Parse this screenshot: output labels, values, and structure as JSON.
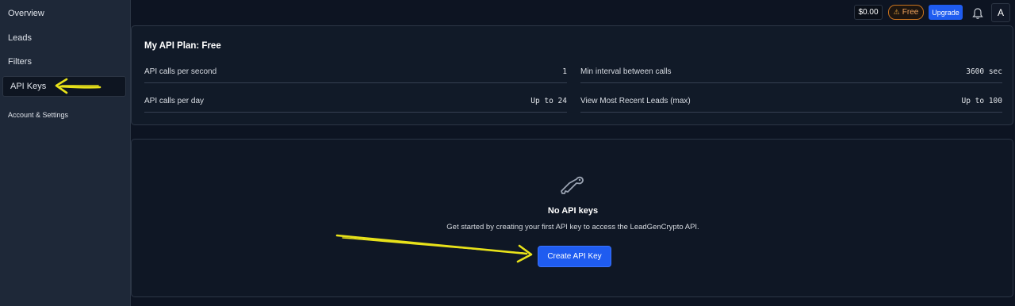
{
  "sidebar": {
    "items": [
      {
        "label": "Overview"
      },
      {
        "label": "Leads"
      },
      {
        "label": "Filters"
      },
      {
        "label": "API Keys",
        "active": true
      },
      {
        "label": "Account & Settings"
      }
    ]
  },
  "topbar": {
    "balance": "$0.00",
    "plan_badge": "Free",
    "upgrade_label": "Upgrade",
    "avatar_initial": "A"
  },
  "plan": {
    "title": "My API Plan: Free",
    "rows": [
      {
        "label": "API calls per second",
        "value": "1"
      },
      {
        "label": "Min interval between calls",
        "value": "3600 sec"
      },
      {
        "label": "API calls per day",
        "value": "Up to 24"
      },
      {
        "label": "View Most Recent Leads (max)",
        "value": "Up to 100"
      }
    ]
  },
  "empty_state": {
    "icon": "key-icon",
    "title": "No API keys",
    "description": "Get started by creating your first API key to access the LeadGenCrypto API.",
    "button_label": "Create API Key"
  },
  "colors": {
    "accent": "#1f5cf0",
    "annotation": "#e8e21a",
    "warning": "#c9731e"
  }
}
